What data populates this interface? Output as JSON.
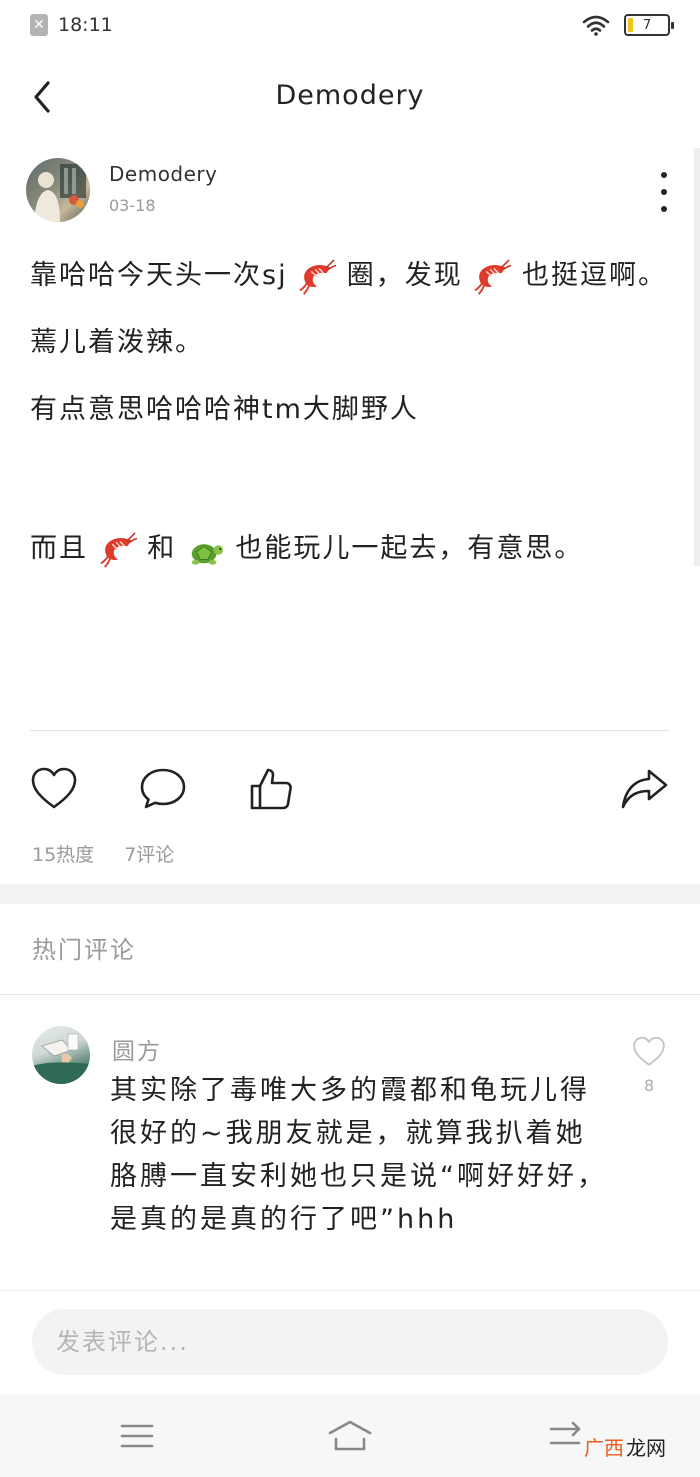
{
  "status_bar": {
    "time": "18:11",
    "battery": "7"
  },
  "nav": {
    "title": "Demodery"
  },
  "post": {
    "author": "Demodery",
    "date": "03-18",
    "paragraphs": [
      [
        "靠哈哈今天头一次sj",
        "圈，发现",
        "也挺逗啊。"
      ],
      [
        "蔫儿着泼辣。"
      ],
      [
        "有点意思哈哈哈神tm大脚野人"
      ],
      [
        "而且",
        "和",
        "也能玩儿一起去，有意思。"
      ]
    ],
    "emoji": {
      "shrimp": "shrimp-emoji",
      "turtle": "turtle-emoji"
    }
  },
  "stats": {
    "heat": "15热度",
    "comments": "7评论"
  },
  "hot_comments": {
    "title": "热门评论",
    "items": [
      {
        "author": "圆方",
        "text": "其实除了毒唯大多的霞都和龟玩儿得很好的~我朋友就是，就算我扒着她胳膊一直安利她也只是说“啊好好好，是真的是真的行了吧”hhh",
        "likes": "8"
      }
    ]
  },
  "comment_bar": {
    "placeholder": "发表评论..."
  },
  "watermark": {
    "part1": "广西",
    "part2": "龙网"
  },
  "colors": {
    "accent_orange": "#e8601c",
    "battery_yellow": "#f0c21b",
    "muted_text": "#9a9a9a"
  }
}
